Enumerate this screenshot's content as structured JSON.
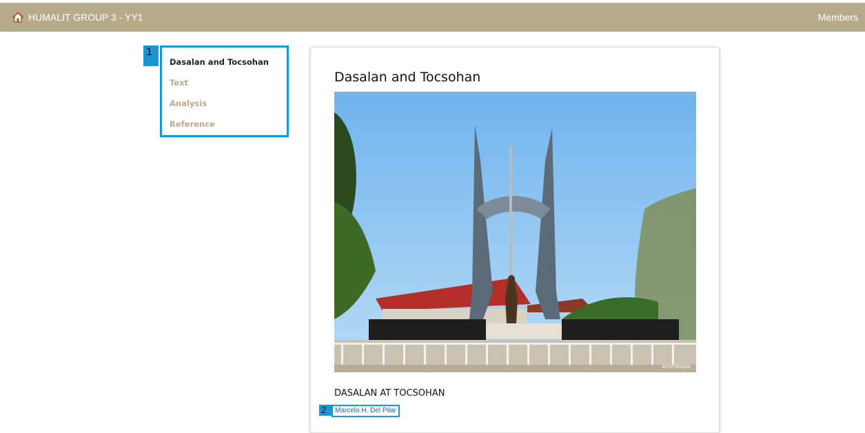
{
  "navbar": {
    "brand_label": "HUMALIT GROUP 3 - YY1",
    "brand_icon": "home-icon",
    "members_label": "Members"
  },
  "sidebar": {
    "badge": "1",
    "items": [
      {
        "label": "Dasalan and Tocsohan",
        "active": true
      },
      {
        "label": "Text",
        "active": false
      },
      {
        "label": "Analysis",
        "active": false
      },
      {
        "label": "Reference",
        "active": false
      }
    ]
  },
  "main": {
    "title": "Dasalan and Tocsohan",
    "image": {
      "watermark": "actembique"
    },
    "section_heading": "DASALAN AT TOCSOHAN",
    "author_badge": "2",
    "author_link": "Marcelo H. Del Pilar"
  },
  "colors": {
    "navbar": "#b5aa8a",
    "highlight": "#1a96d4",
    "link": "#2a52be"
  }
}
